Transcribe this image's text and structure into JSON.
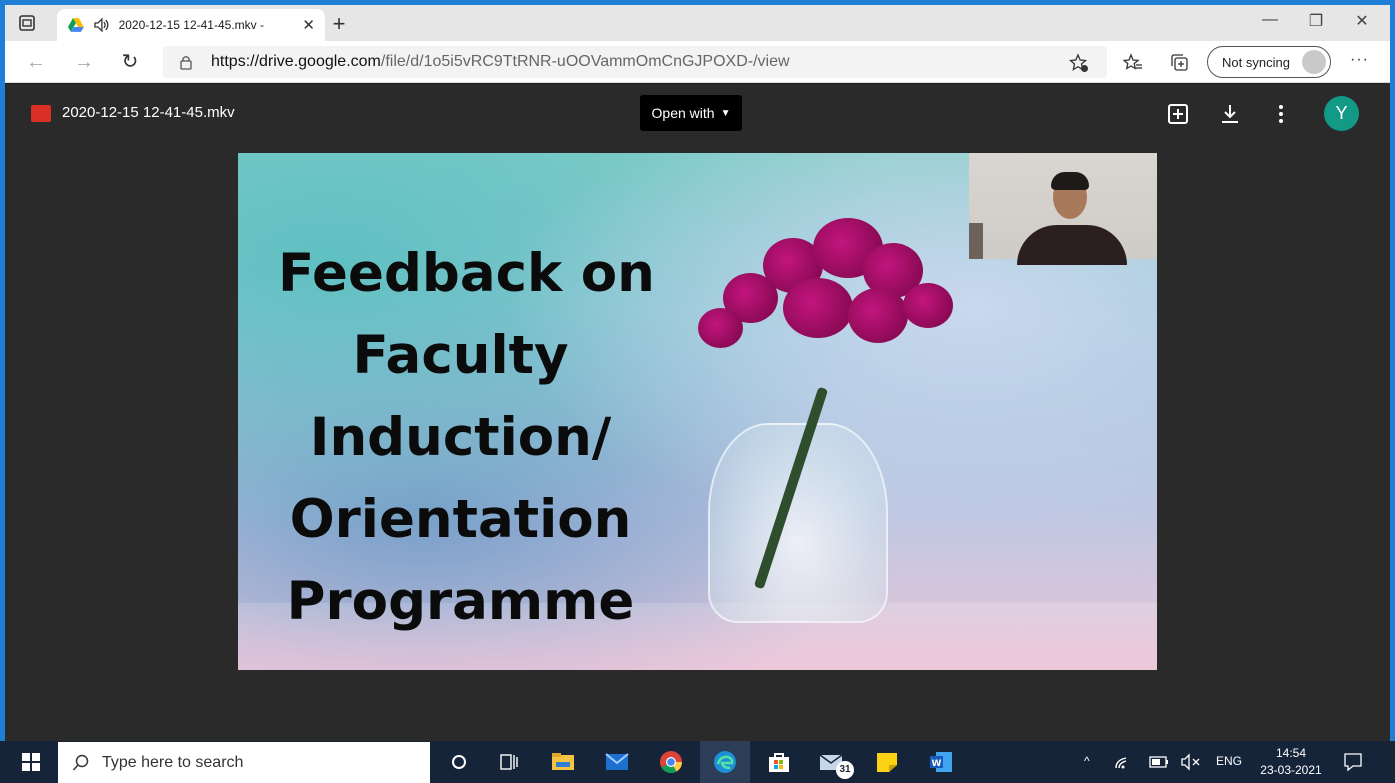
{
  "browser": {
    "tab_title": "2020-12-15 12-41-45.mkv -",
    "tab_close": "✕",
    "new_tab": "+",
    "url_host": "https://drive.google.com",
    "url_path": "/file/d/1o5i5vRC9TtRNR-uOOVammOmCnGJPOXD-/view",
    "sync_label": "Not syncing",
    "more": "···",
    "window_controls": [
      "—",
      "❐",
      "✕"
    ]
  },
  "viewer": {
    "file_name": "2020-12-15 12-41-45.mkv",
    "open_with": "Open with",
    "avatar_initial": "Y"
  },
  "slide": {
    "lines": [
      "Feedback on",
      "Faculty",
      "Induction/",
      "Orientation",
      "Programme"
    ]
  },
  "taskbar": {
    "search_placeholder": "Type here to search",
    "lang": "ENG",
    "time": "14:54",
    "date": "23-03-2021",
    "mail_badge": "31"
  }
}
